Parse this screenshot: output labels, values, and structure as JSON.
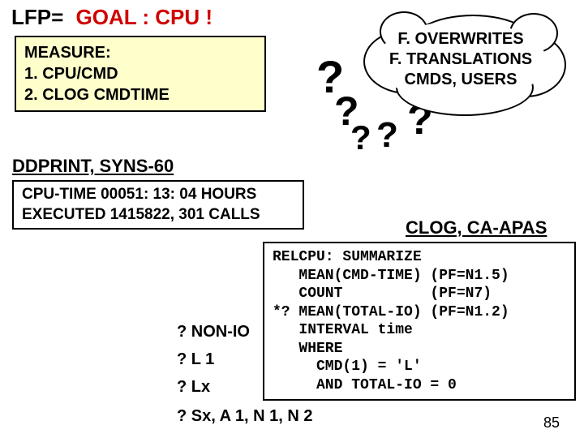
{
  "header": {
    "lfp_label": "LFP=",
    "goal": "GOAL : CPU !"
  },
  "measure": {
    "title": "MEASURE:",
    "line1": "1.  CPU/CMD",
    "line2": "2.  CLOG CMDTIME"
  },
  "cloud": {
    "line1": "F. OVERWRITES",
    "line2": "F. TRANSLATIONS",
    "line3": "CMDS, USERS"
  },
  "qmarks": {
    "q1": "?",
    "q2": "?",
    "q3": "?",
    "q4": "?",
    "q5": "?"
  },
  "ddprint": "DDPRINT, SYNS-60",
  "cpu_box": {
    "line1": "CPU-TIME   00051: 13: 04   HOURS",
    "line2": "EXECUTED 1415822, 301 CALLS"
  },
  "clog_label": "CLOG, CA-APAS",
  "relcpu": "RELCPU: SUMMARIZE\n   MEAN(CMD-TIME) (PF=N1.5)\n   COUNT          (PF=N7)\n*? MEAN(TOTAL-IO) (PF=N1.2)\n   INTERVAL time\n   WHERE\n     CMD(1) = 'L'\n     AND TOTAL-IO = 0",
  "qitems": {
    "nonio": "? NON-IO",
    "l1": "? L 1",
    "lx": "? Lx",
    "sx": "? Sx, A 1, N 1, N 2"
  },
  "page": "85"
}
